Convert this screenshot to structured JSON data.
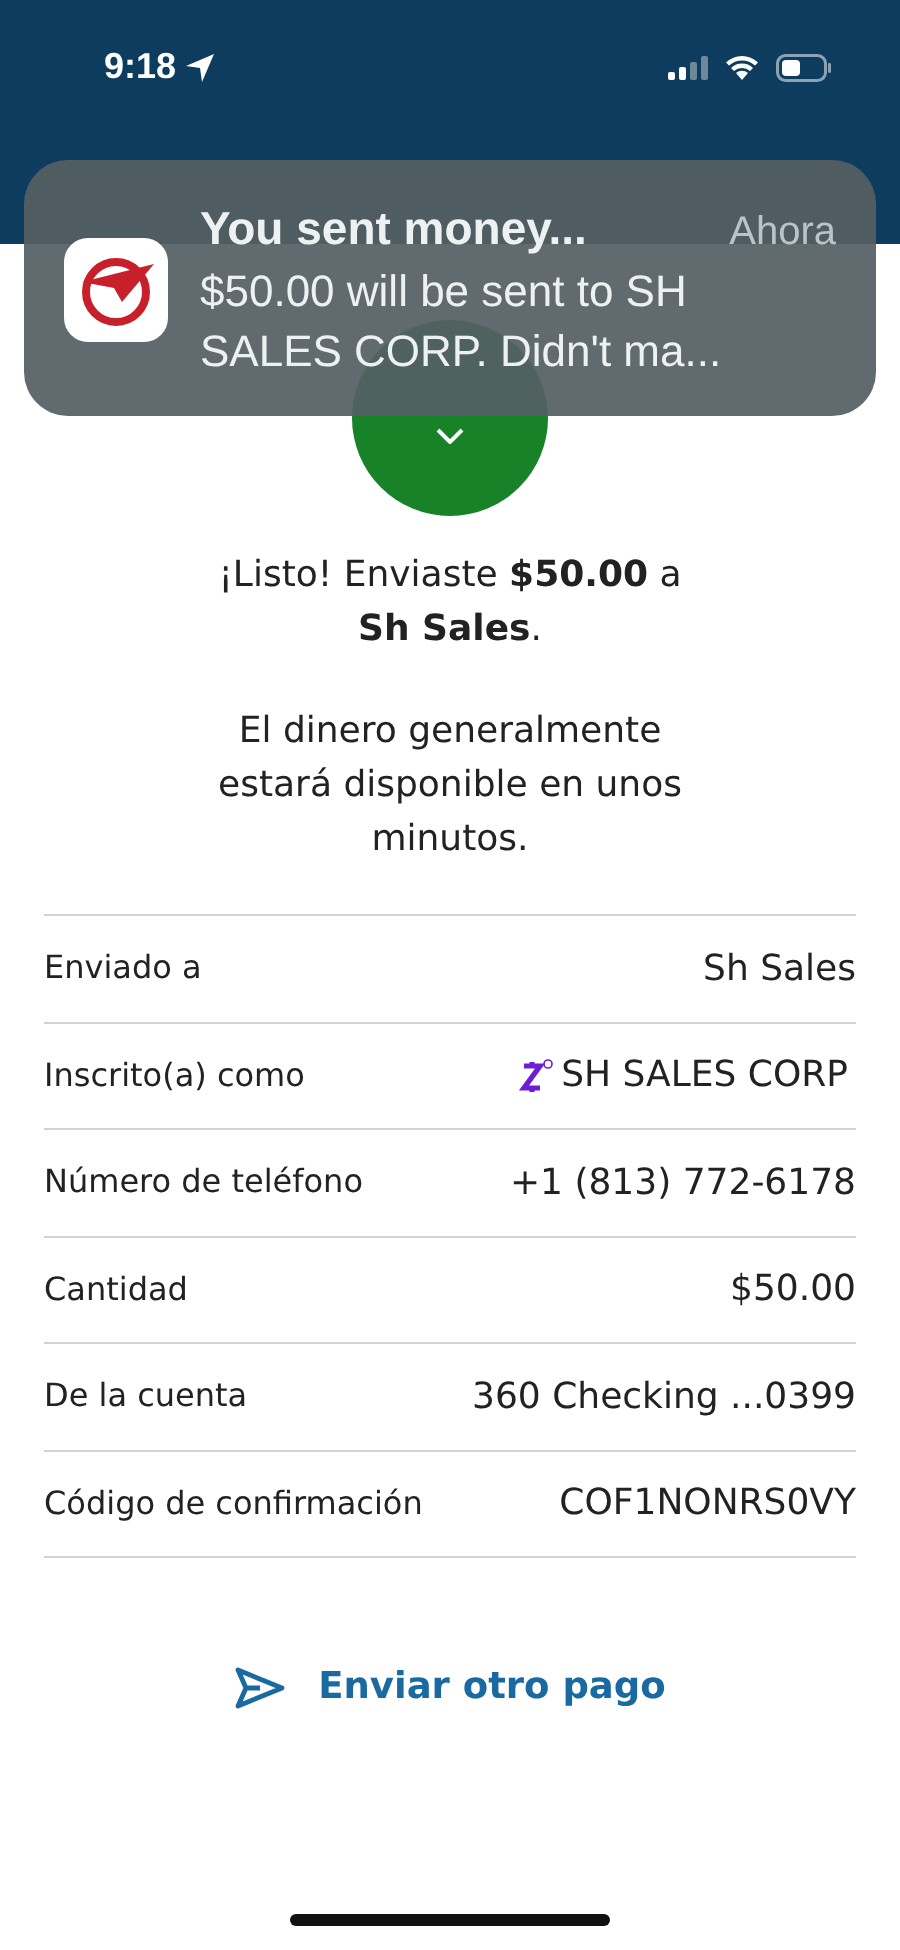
{
  "status_bar": {
    "time": "9:18"
  },
  "notification": {
    "title": "You sent money...",
    "time": "Ahora",
    "body": "$50.00 will be sent to SH SALES CORP. Didn't ma..."
  },
  "confirmation": {
    "headline": "¡Listo! Enviaste **$50.00** a **Sh Sales**.",
    "note": "El dinero generalmente estará disponible en unos minutos."
  },
  "details": [
    {
      "kind": "plain",
      "label": "Enviado a",
      "value": "Sh Sales"
    },
    {
      "kind": "enrolled",
      "label": "Inscrito(a) como",
      "value": "SH SALES CORP"
    },
    {
      "kind": "plain",
      "label": "Número de teléfono",
      "value": "+1 (813) 772-6178"
    },
    {
      "kind": "plain",
      "label": "Cantidad",
      "value": "$50.00"
    },
    {
      "kind": "plain",
      "label": "De la cuenta",
      "value": "360 Checking ...0399"
    },
    {
      "kind": "plain",
      "label": "Código de confirmación",
      "value": "COF1NONRS0VY"
    }
  ],
  "action": {
    "label": "Enviar otro pago"
  }
}
